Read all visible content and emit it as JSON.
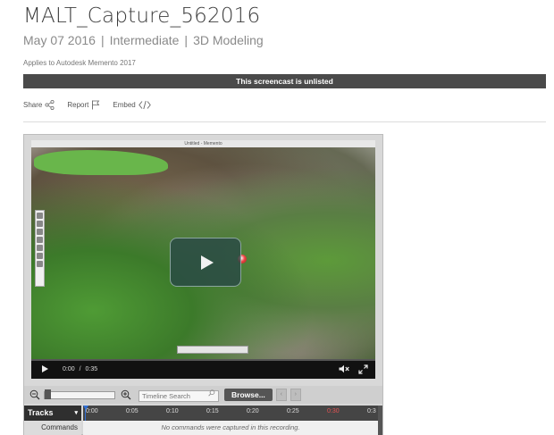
{
  "header": {
    "title": "MALT_Capture_562016",
    "date": "May 07 2016",
    "level": "Intermediate",
    "category": "3D Modeling",
    "separator": "|",
    "applies_to": "Applies to Autodesk Memento 2017"
  },
  "banner": {
    "text": "This screencast is unlisted"
  },
  "actions": {
    "share": "Share",
    "report": "Report",
    "embed": "Embed"
  },
  "video": {
    "window_title": "Untitled - Memento",
    "current_time": "0:00",
    "time_separator": "/",
    "duration": "0:35"
  },
  "timeline": {
    "search_placeholder": "Timeline Search",
    "browse_label": "Browse...",
    "tracks_label": "Tracks",
    "commands_label": "Commands",
    "empty_message": "No commands were captured in this recording.",
    "ticks": [
      "0:00",
      "0:05",
      "0:10",
      "0:15",
      "0:20",
      "0:25",
      "0:30",
      "0:3"
    ]
  },
  "colors": {
    "banner_bg": "#4a4a4a",
    "accent_red": "#e35353",
    "cursor_blue": "#2f6fd6"
  }
}
